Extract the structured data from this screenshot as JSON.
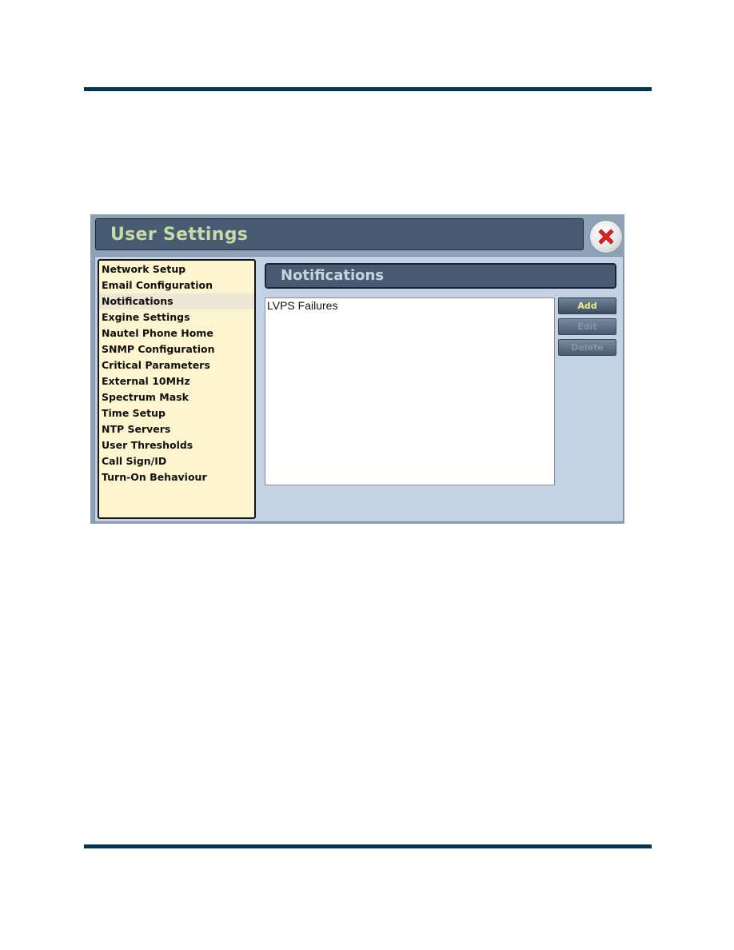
{
  "window": {
    "title": "User Settings",
    "close_icon": "close-x-icon"
  },
  "sidebar": {
    "selected_index": 2,
    "items": [
      {
        "label": "Network Setup"
      },
      {
        "label": "Email Configuration"
      },
      {
        "label": "Notifications"
      },
      {
        "label": "Exgine Settings"
      },
      {
        "label": "Nautel Phone Home"
      },
      {
        "label": "SNMP Configuration"
      },
      {
        "label": "Critical Parameters"
      },
      {
        "label": "External 10MHz"
      },
      {
        "label": "Spectrum Mask"
      },
      {
        "label": "Time Setup"
      },
      {
        "label": "NTP Servers"
      },
      {
        "label": "User Thresholds"
      },
      {
        "label": "Call Sign/ID"
      },
      {
        "label": "Turn-On Behaviour"
      }
    ]
  },
  "panel": {
    "title": "Notifications",
    "list": [
      "LVPS Failures"
    ],
    "buttons": {
      "add": {
        "label": "Add",
        "enabled": true
      },
      "edit": {
        "label": "Edit",
        "enabled": false
      },
      "delete": {
        "label": "Delete",
        "enabled": false
      }
    }
  },
  "colors": {
    "page_rule": "#04364f",
    "title_bg": "#475b72",
    "title_text": "#c9d9a8",
    "sidebar_bg": "#fdf5cf",
    "body_bg": "#c4d2e6",
    "button_enabled_text": "#eef07a"
  }
}
